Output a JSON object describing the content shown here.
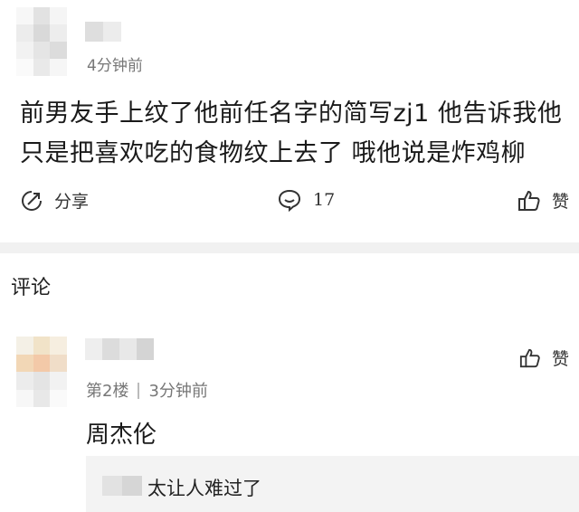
{
  "post": {
    "time": "4分钟前",
    "text": "前男友手上纹了他前任名字的简写zj1 他告诉我他只是把喜欢吃的食物纹上去了 哦他说是炸鸡柳",
    "share_label": "分享",
    "comment_count": "17",
    "like_label": "赞"
  },
  "comments_section": {
    "title": "评论",
    "comment": {
      "floor": "第2楼",
      "time": "3分钟前",
      "text": "周杰伦",
      "like_label": "赞",
      "reply": {
        "text": "太让人难过了"
      }
    }
  },
  "colors": {
    "divider": "#f1f1f1",
    "reply_bg": "#f3f3f3",
    "meta_text": "#777777"
  }
}
